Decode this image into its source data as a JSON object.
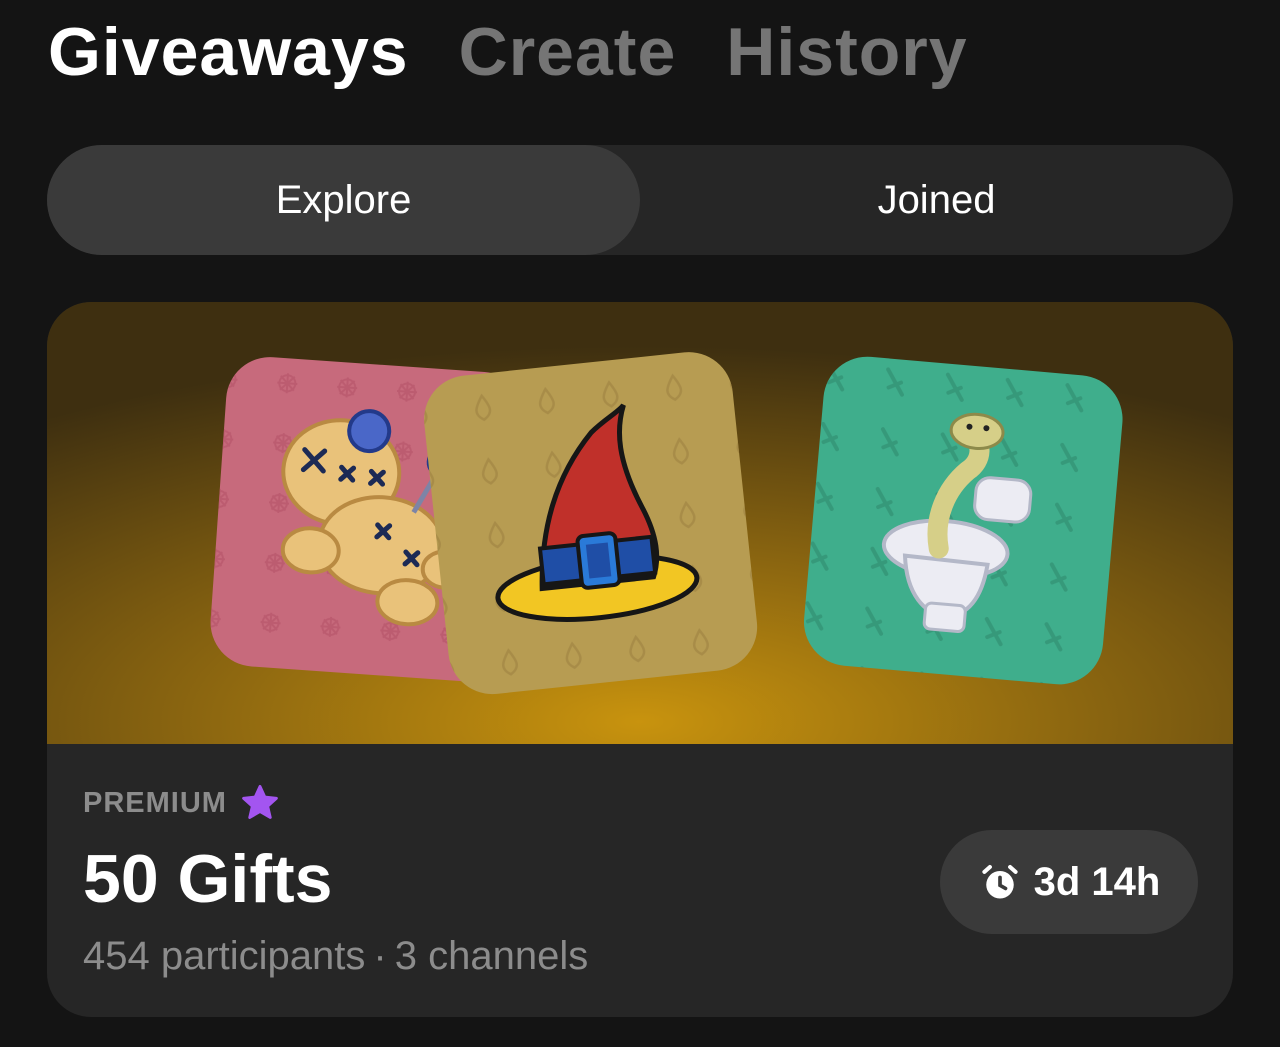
{
  "top_tabs": [
    {
      "label": "Giveaways",
      "active": true
    },
    {
      "label": "Create",
      "active": false
    },
    {
      "label": "History",
      "active": false
    }
  ],
  "segmented": {
    "explore": "Explore",
    "joined": "Joined",
    "selected": "Explore"
  },
  "giveaway_card": {
    "banner_items": [
      {
        "name": "voodoo-doll",
        "bg": "#c76a7c"
      },
      {
        "name": "witch-hat",
        "bg": "#b79c52"
      },
      {
        "name": "snake-in-toilet",
        "bg": "#3fae8c"
      }
    ],
    "badge_label": "PREMIUM",
    "badge_icon": "star-icon",
    "title": "50 Gifts",
    "participants": "454 participants",
    "separator": "·",
    "channels": "3 channels",
    "timer": "3d 14h",
    "timer_icon": "alarm-clock-icon",
    "accent_purple": "#a355f0"
  }
}
